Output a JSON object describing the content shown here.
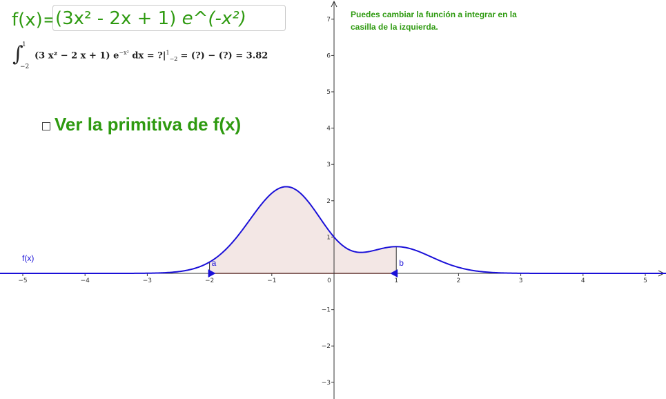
{
  "function_bar": {
    "label": "f(x)=",
    "input_poly": "(3x² - 2x + 1) ",
    "input_exp": "e^(-x²)"
  },
  "integral": {
    "upper_limit": "1",
    "lower_limit": "−2",
    "integrand": "(3 x² − 2 x + 1)  e",
    "exponent": "−x²",
    "dx": " dx = ?|",
    "eval_upper": "1",
    "eval_lower": "−2",
    "result_text": "= (?) − (?) = 3.82"
  },
  "note": "Puedes cambiar la función a integrar en la casilla de la izquierda.",
  "toggle": {
    "label": "Ver la primitiva de f(x)",
    "checked": false
  },
  "graph": {
    "curve_label": "f(x)",
    "point_a_label": "a",
    "point_b_label": "b",
    "a_value": -2,
    "b_value": 1,
    "x_ticks": [
      "−5",
      "−4",
      "−3",
      "−2",
      "−1",
      "0",
      "1",
      "2",
      "3",
      "4",
      "5"
    ],
    "y_ticks": [
      "−3",
      "−2",
      "−1",
      "1",
      "2",
      "3",
      "4",
      "5",
      "6",
      "7"
    ],
    "colors": {
      "curve": "#1a10d8",
      "area_fill": "#f3e7e5",
      "area_base": "#c0392b",
      "slider": "#1a10d8",
      "axis": "#333333",
      "text_green": "#2e9a10"
    }
  }
}
